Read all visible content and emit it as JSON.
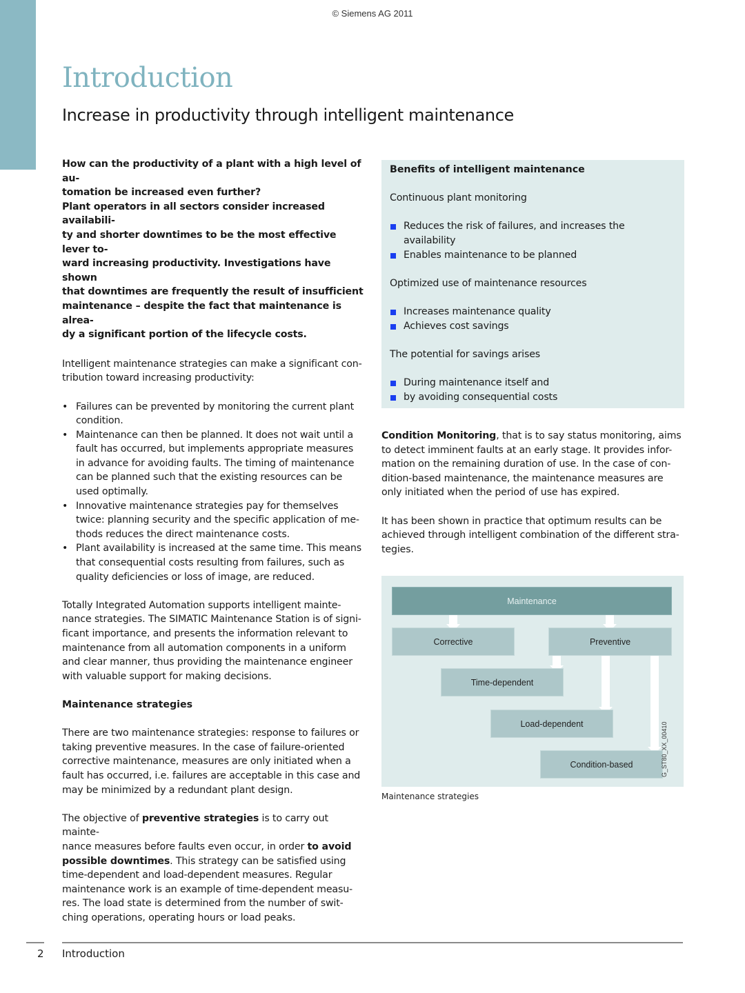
{
  "header": {
    "copyright": "© Siemens AG 2011"
  },
  "title": "Introduction",
  "subtitle": "Increase in productivity through intelligent maintenance",
  "left_column": {
    "intro_bold": "How can the productivity of a plant with a high level of automation be increased even further?\nPlant operators in all sectors consider increased availability and shorter downtimes to be the most effective lever toward increasing productivity. Investigations have shown that downtimes are frequently the result of insufficient maintenance – despite the fact that maintenance is already a significant portion of the lifecycle costs.",
    "intro_bold_lines": [
      "How can the productivity of a plant with a high level of au-",
      "tomation be increased even further?",
      "Plant operators in all sectors consider increased availabili-",
      "ty and shorter downtimes to be the most effective lever to-",
      "ward increasing productivity. Investigations have shown",
      "that downtimes are frequently the result of insufficient",
      "maintenance – despite the fact that maintenance is alrea-",
      "dy a significant portion of the lifecycle costs."
    ],
    "strategies_intro_lines": [
      "Intelligent maintenance strategies can make a significant con-",
      "tribution toward increasing productivity:"
    ],
    "bullet_glyph": "•",
    "bullets": [
      {
        "lines": [
          "Failures can be prevented by monitoring the current plant",
          "condition."
        ]
      },
      {
        "lines": [
          "Maintenance can then be planned. It does not wait until a",
          "fault has occurred, but implements appropriate measures",
          "in advance for avoiding faults. The timing of maintenance",
          "can be planned such that the existing resources can be",
          "used optimally."
        ]
      },
      {
        "lines": [
          "Innovative maintenance strategies pay for themselves",
          "twice: planning security and the specific application of me-",
          "thods reduces the direct maintenance costs."
        ]
      },
      {
        "lines": [
          "Plant availability is increased at the same time. This means",
          "that consequential costs resulting from failures, such as",
          "quality deficiencies or loss of image, are reduced."
        ]
      }
    ],
    "tia_lines": [
      "Totally Integrated Automation supports intelligent mainte-",
      "nance strategies. The SIMATIC Maintenance Station is of signi-",
      "ficant importance, and presents the information relevant to",
      "maintenance from all automation components in a uniform",
      "and clear manner, thus providing the maintenance engineer",
      "with valuable support for making decisions."
    ],
    "strategies_heading": "Maintenance strategies",
    "two_strategies_lines": [
      "There are two maintenance strategies: response to failures or",
      "taking preventive measures. In the case of failure-oriented",
      "corrective maintenance, measures are only initiated when a",
      "fault has occurred, i.e. failures are acceptable in this case and",
      "may be minimized by a redundant plant design."
    ],
    "objective": {
      "l1_a": "The objective of ",
      "l1_b": "preventive strategies",
      "l1_c": " is to carry out mainte-",
      "l2_a": "nance measures before faults even occur, in order ",
      "l2_b": "to avoid",
      "l3_a": "possible downtimes",
      "l3_b": ". This strategy can be satisfied using",
      "rest_lines": [
        "time-dependent and load-dependent measures. Regular",
        "maintenance work is an example of time-dependent measu-",
        "res. The load state is determined from the number of swit-",
        "ching operations, operating hours or load peaks."
      ]
    }
  },
  "benefits_box": {
    "heading": "Benefits of intelligent maintenance",
    "groups": [
      {
        "title": "Continuous plant monitoring",
        "items": [
          [
            "Reduces the risk of failures, and increases the",
            "availability"
          ],
          [
            "Enables maintenance to be planned"
          ]
        ]
      },
      {
        "title": "Optimized use of maintenance resources",
        "items": [
          [
            "Increases maintenance quality"
          ],
          [
            "Achieves cost savings"
          ]
        ]
      },
      {
        "title": "The potential for savings arises",
        "items": [
          [
            "During maintenance itself and"
          ],
          [
            "by avoiding consequential costs"
          ]
        ]
      }
    ],
    "bullet_color": "#1a3ef0"
  },
  "condition_monitoring": {
    "bold": "Condition Monitoring",
    "l1_rest": ", that is to say status monitoring, aims",
    "rest_lines": [
      "to detect imminent faults at an early stage. It provides infor-",
      "mation on the remaining duration of use. In the case of con-",
      "dition-based maintenance, the maintenance measures are",
      "only initiated when the period of use has expired."
    ],
    "practice_lines": [
      "It has been shown in practice that optimum results can be",
      "achieved through intelligent combination of the different stra-",
      "tegies."
    ]
  },
  "diagram": {
    "nodes": {
      "root": "Maintenance",
      "corrective": "Corrective",
      "preventive": "Preventive",
      "time_dependent": "Time-dependent",
      "load_dependent": "Load-dependent",
      "condition_based": "Condition-based"
    },
    "edges": [
      [
        "Maintenance",
        "Corrective"
      ],
      [
        "Maintenance",
        "Preventive"
      ],
      [
        "Preventive",
        "Time-dependent"
      ],
      [
        "Preventive",
        "Load-dependent"
      ],
      [
        "Preventive",
        "Condition-based"
      ]
    ],
    "figure_id": "G_ST80_XX_00410",
    "caption": "Maintenance strategies",
    "colors": {
      "background": "#dfecec",
      "root_box": "#749e9f",
      "child_box": "#adc7c9",
      "arrow": "#ffffff"
    }
  },
  "footer": {
    "page_number": "2",
    "section": "Introduction"
  },
  "colors": {
    "accent": "#7fb3bf",
    "side_bar": "#8bb9c4"
  }
}
